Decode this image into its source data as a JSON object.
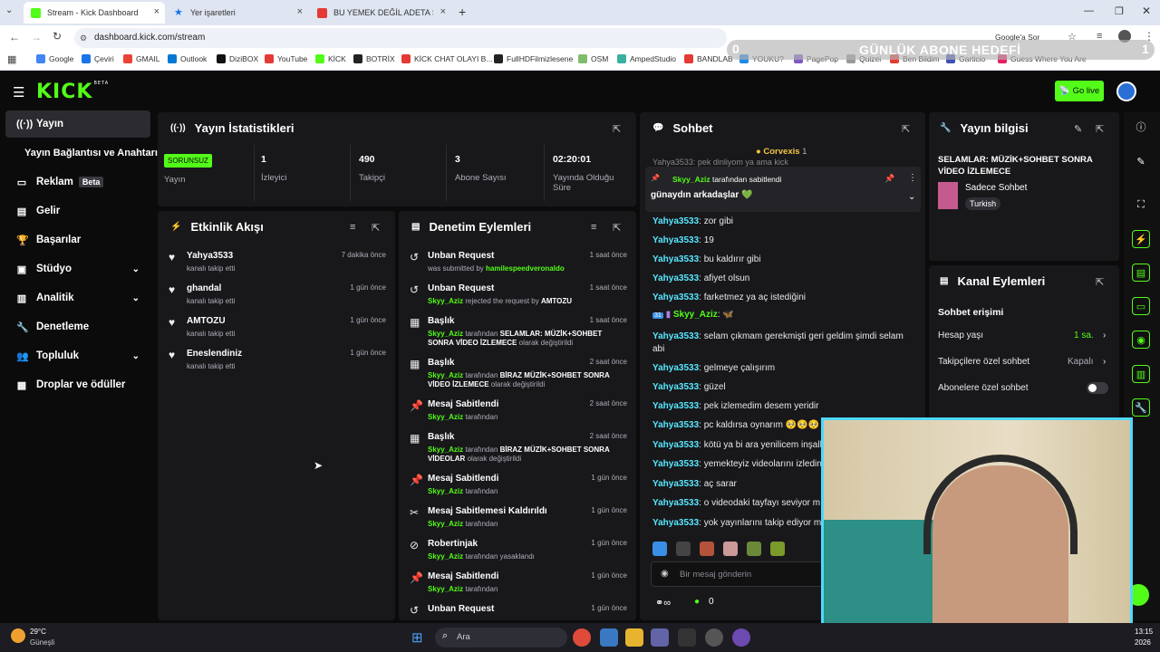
{
  "browser": {
    "tabs": [
      {
        "title": "Stream - Kick Dashboard",
        "active": true,
        "color": "#53fc18"
      },
      {
        "title": "Yer işaretleri",
        "active": false,
        "color": "#1a73e8"
      },
      {
        "title": "BU YEMEK DEĞİL ADETA ŞÖLE",
        "active": false,
        "color": "#e53935"
      }
    ],
    "url": "dashboard.kick.com/stream",
    "bookmarks": [
      "Google",
      "Çeviri",
      "GMAIL",
      "Outlook",
      "DiziBOX",
      "YouTube",
      "KİCK",
      "BOTRİX",
      "KİCK CHAT OLAYI B...",
      "FullHDFilmizlesene",
      "OSM",
      "AmpedStudio",
      "BANDLAB",
      "YOUKU?",
      "PagePop",
      "Quizei",
      "Ben Bildim",
      "Garticio",
      "Guess Where You Are"
    ],
    "google_label": "Google'a Sor"
  },
  "overlay": {
    "left": "0",
    "title": "GÜNLÜK ABONE HEDEFİ",
    "right": "1"
  },
  "topnav": {
    "logo": "KICK",
    "logo_sup": "BETA",
    "go_live": "Go live"
  },
  "sidebar": {
    "items": [
      {
        "label": "Yayın",
        "icon": "broadcast-icon"
      },
      {
        "label": "Yayın Bağlantısı ve Anahtarı",
        "icon": ""
      },
      {
        "label": "Reklam",
        "icon": "ad-icon",
        "badge": "Beta"
      },
      {
        "label": "Gelir",
        "icon": "income-icon"
      },
      {
        "label": "Başarılar",
        "icon": "trophy-icon"
      },
      {
        "label": "Stüdyo",
        "icon": "studio-icon"
      },
      {
        "label": "Analitik",
        "icon": "analytics-icon"
      },
      {
        "label": "Denetleme",
        "icon": "wrench-icon"
      },
      {
        "label": "Topluluk",
        "icon": "community-icon"
      },
      {
        "label": "Droplar ve ödüller",
        "icon": "drops-icon"
      }
    ]
  },
  "stats": {
    "title": "Yayın İstatistikleri",
    "status_badge": "SORUNSUZ",
    "status_label": "Yayın",
    "viewers_value": "1",
    "viewers_label": "İzleyici",
    "followers_value": "490",
    "followers_label": "Takipçi",
    "subs_value": "3",
    "subs_label": "Abone Sayısı",
    "uptime_value": "02:20:01",
    "uptime_label": "Yayında Olduğu Süre"
  },
  "activity": {
    "title": "Etkinlik Akışı",
    "items": [
      {
        "user": "Yahya3533",
        "text": "kanalı takip etti",
        "time": "7 dakika önce"
      },
      {
        "user": "ghandal",
        "text": "kanalı takip etti",
        "time": "1 gün önce"
      },
      {
        "user": "AMTOZU",
        "text": "kanalı takip etti",
        "time": "1 gün önce"
      },
      {
        "user": "Eneslendiniz",
        "text": "kanalı takip etti",
        "time": "1 gün önce"
      }
    ]
  },
  "moderation": {
    "title": "Denetim Eylemleri",
    "items": [
      {
        "title": "Unban Request",
        "a": "was submitted by ",
        "b": "hamilespeedveronaldo",
        "c": "",
        "d": "",
        "time": "1 saat önce"
      },
      {
        "title": "Unban Request",
        "a": "",
        "b": "Skyy_Aziz",
        "c": " rejected the request by ",
        "d": "AMTOZU",
        "time": "1 saat önce"
      },
      {
        "title": "Başlık",
        "a": "",
        "b": "Skyy_Aziz",
        "c": " tarafından ",
        "d": "SELAMLAR: MÜZİK+SOHBET SONRA VİDEO İZLEMECE",
        "e": " olarak değiştirildi",
        "time": "1 saat önce"
      },
      {
        "title": "Başlık",
        "a": "",
        "b": "Skyy_Aziz",
        "c": " tarafından ",
        "d": "BİRAZ MÜZİK+SOHBET SONRA VİDEO İZLEMECE",
        "e": " olarak değiştirildi",
        "time": "2 saat önce"
      },
      {
        "title": "Mesaj Sabitlendi",
        "a": "",
        "b": "Skyy_Aziz",
        "c": " tarafından",
        "d": "",
        "time": "2 saat önce"
      },
      {
        "title": "Başlık",
        "a": "",
        "b": "Skyy_Aziz",
        "c": " tarafından ",
        "d": "BİRAZ MÜZİK+SOHBET SONRA VİDEOLAR",
        "e": " olarak değiştirildi",
        "time": "2 saat önce"
      },
      {
        "title": "Mesaj Sabitlendi",
        "a": "",
        "b": "Skyy_Aziz",
        "c": " tarafından",
        "d": "",
        "time": "1 gün önce"
      },
      {
        "title": "Mesaj Sabitlemesi Kaldırıldı",
        "a": "",
        "b": "Skyy_Aziz",
        "c": " tarafından",
        "d": "",
        "time": "1 gün önce"
      },
      {
        "title": "Robertinjak",
        "a": "",
        "b": "Skyy_Aziz",
        "c": " tarafından yasaklandı",
        "d": "",
        "time": "1 gün önce"
      },
      {
        "title": "Mesaj Sabitlendi",
        "a": "",
        "b": "Skyy_Aziz",
        "c": " tarafından",
        "d": "",
        "time": "1 gün önce"
      },
      {
        "title": "Unban Request",
        "a": "",
        "b": "",
        "c": "",
        "d": "",
        "time": "1 gün önce"
      }
    ]
  },
  "chat": {
    "title": "Sohbet",
    "top_user": "Corvexis",
    "top_count": "1",
    "pinned_by": "Skyy_Aziz",
    "pinned_suffix": " tarafından sabitlendi",
    "pinned_msg": "günaydın arkadaşlar 💚",
    "cut_msg": "Yahya3533: pek dinliyom ya ama kick",
    "messages": [
      {
        "u": "Yahya3533",
        "m": "zor gibi"
      },
      {
        "u": "Yahya3533",
        "m": "19"
      },
      {
        "u": "Yahya3533",
        "m": "bu kaldırır gibi"
      },
      {
        "u": "Yahya3533",
        "m": "afiyet olsun"
      },
      {
        "u": "Yahya3533",
        "m": "farketmez ya aç istediğini"
      },
      {
        "u": "Skyy_Aziz",
        "m": "🦋"
      },
      {
        "u": "Yahya3533",
        "m": "selam çıkmam gerekmişti geri geldim şimdi selam"
      },
      {
        "u": "",
        "m": "abi"
      },
      {
        "u": "Yahya3533",
        "m": "gelmeye çalışırım"
      },
      {
        "u": "Yahya3533",
        "m": "güzel"
      },
      {
        "u": "Yahya3533",
        "m": "pek izlemedim desem yeridir"
      },
      {
        "u": "Yahya3533",
        "m": "pc kaldırsa oynarım 🥺🥺🥺"
      },
      {
        "u": "Yahya3533",
        "m": "kötü ya bi ara yenilicem inşall"
      },
      {
        "u": "Yahya3533",
        "m": "yemekteyiz videolarını izledin"
      },
      {
        "u": "Yahya3533",
        "m": "aç sarar"
      },
      {
        "u": "Yahya3533",
        "m": "o videodaki tayfayı seviyor m"
      },
      {
        "u": "Yahya3533",
        "m": "yok yayınlarını takip ediyor m"
      }
    ],
    "placeholder": "Bir mesaj gönderin",
    "points": "0"
  },
  "info": {
    "title": "Yayın bilgisi",
    "stream_title": "SELAMLAR: MÜZİK+SOHBET SONRA VİDEO İZLEMECE",
    "category": "Sadece Sohbet",
    "tag": "Turkish"
  },
  "channel": {
    "title": "Kanal Eylemleri",
    "section": "Sohbet erişimi",
    "account_age_label": "Hesap yaşı",
    "account_age_value": "1 sa.",
    "followers_only_label": "Takipçilere özel sohbet",
    "followers_only_value": "Kapalı",
    "subs_only_label": "Abonelere özel sohbet"
  },
  "taskbar": {
    "weather_temp": "29°C",
    "weather_label": "Güneşli",
    "search": "Ara",
    "clock_time": "13:15",
    "clock_date": "2026"
  }
}
